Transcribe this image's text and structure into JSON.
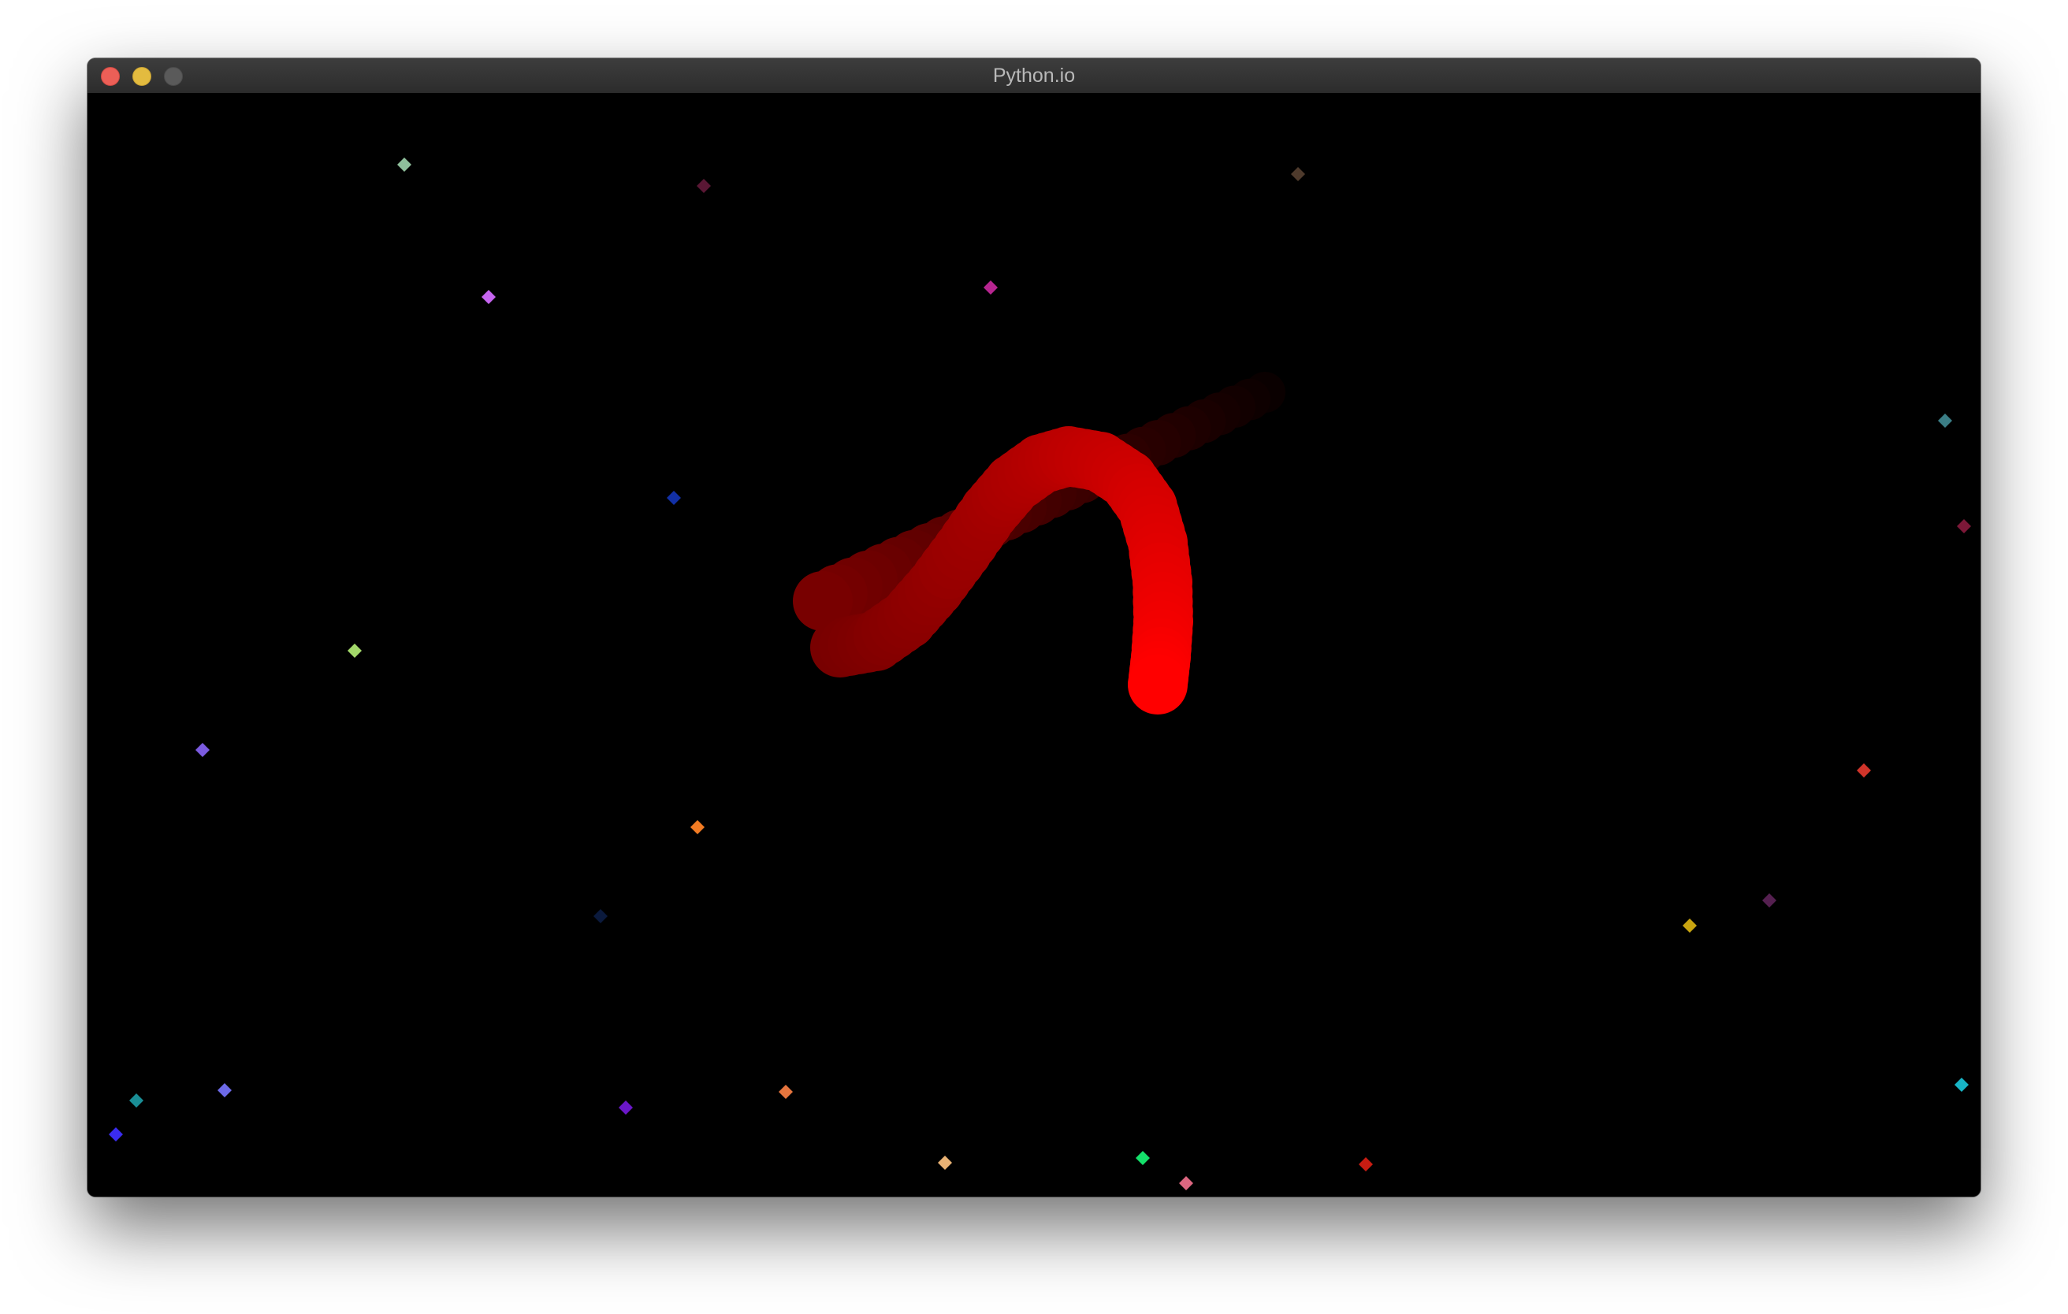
{
  "window": {
    "title": "Python.io"
  },
  "game": {
    "background": "#000000",
    "player_color": "#ff0000",
    "food_pellets": [
      {
        "color": "#8fbf9c"
      },
      {
        "color": "#5a1734"
      },
      {
        "color": "#4e3a2c"
      },
      {
        "color": "#c665f0"
      },
      {
        "color": "#b6258f"
      },
      {
        "color": "#3b7e86"
      },
      {
        "color": "#1230a6"
      },
      {
        "color": "#7c1838"
      },
      {
        "color": "#a3d86a"
      },
      {
        "color": "#7b5be0"
      },
      {
        "color": "#d0342a"
      },
      {
        "color": "#f27b23"
      },
      {
        "color": "#552050"
      },
      {
        "color": "#0b1a3d"
      },
      {
        "color": "#c8a410"
      },
      {
        "color": "#18b4c6"
      },
      {
        "color": "#1a8e96"
      },
      {
        "color": "#6d6ae8"
      },
      {
        "color": "#6a17c8"
      },
      {
        "color": "#e6753e"
      },
      {
        "color": "#3a2cf0"
      },
      {
        "color": "#e9b274"
      },
      {
        "color": "#14e06a"
      },
      {
        "color": "#dc6680"
      },
      {
        "color": "#c81c12"
      }
    ]
  }
}
